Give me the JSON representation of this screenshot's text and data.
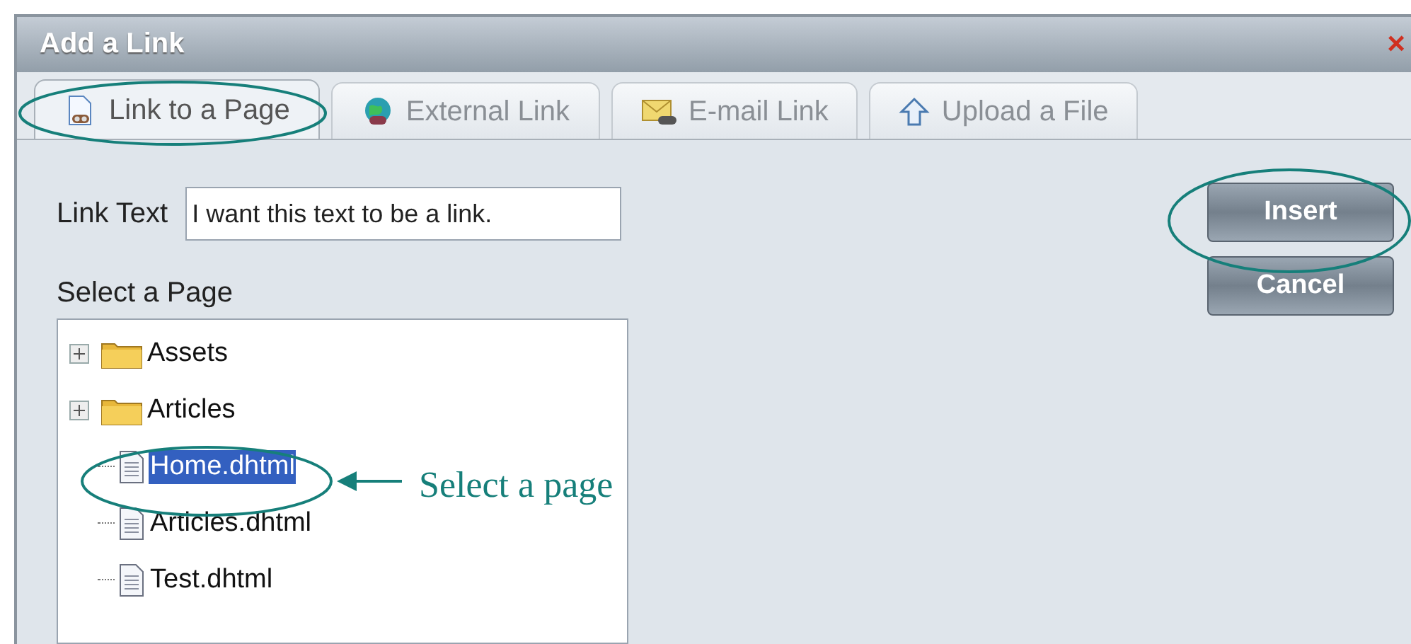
{
  "window": {
    "title": "Add a Link",
    "close": "×"
  },
  "tabs": [
    {
      "label": "Link to a Page",
      "kind": "page",
      "selected": true
    },
    {
      "label": "External Link",
      "kind": "globe",
      "selected": false
    },
    {
      "label": "E-mail Link",
      "kind": "mail",
      "selected": false
    },
    {
      "label": "Upload a File",
      "kind": "upload",
      "selected": false
    }
  ],
  "link_text": {
    "label": "Link Text",
    "value": "I want this text to be a link."
  },
  "page_tree": {
    "label": "Select a Page",
    "items": [
      {
        "label": "Assets",
        "kind": "folder",
        "expanded": false,
        "selected": false
      },
      {
        "label": "Articles",
        "kind": "folder",
        "expanded": false,
        "selected": false
      },
      {
        "label": "Home.dhtml",
        "kind": "file",
        "selected": true
      },
      {
        "label": "Articles.dhtml",
        "kind": "file",
        "selected": false
      },
      {
        "label": "Test.dhtml",
        "kind": "file",
        "selected": false
      }
    ]
  },
  "buttons": [
    "Insert",
    "Cancel"
  ],
  "annotation": {
    "text": "Select a page"
  }
}
